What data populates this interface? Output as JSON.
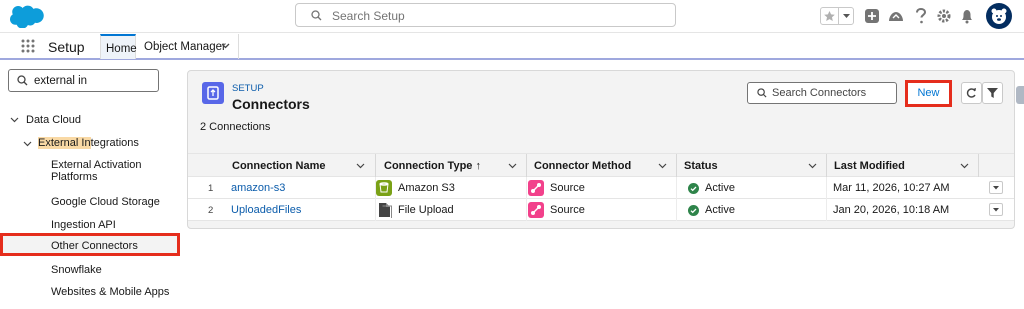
{
  "header": {
    "search_placeholder": "Search Setup",
    "icons": [
      "salesforce-cloud-logo",
      "favorites-star-icon",
      "favorites-dropdown-icon",
      "global-actions-plus-icon",
      "trailhead-icon",
      "help-icon",
      "setup-gear-icon",
      "notifications-bell-icon",
      "user-avatar"
    ]
  },
  "nav": {
    "app_name": "Setup",
    "tabs": [
      {
        "label": "Home"
      },
      {
        "label": "Object Manager"
      }
    ]
  },
  "sidebar": {
    "search_value": "external in",
    "tree": {
      "root": "Data Cloud",
      "group": "External Integrations",
      "group_highlight": "External In",
      "group_rest": "tegrations",
      "items": [
        {
          "label": "External Activation"
        },
        {
          "label": "Platforms"
        },
        {
          "label": "Google Cloud Storage"
        },
        {
          "label": "Ingestion API"
        },
        {
          "label": "Other Connectors"
        },
        {
          "label": "Snowflake"
        },
        {
          "label": "Websites & Mobile Apps"
        }
      ]
    }
  },
  "main": {
    "breadcrumb": "SETUP",
    "title": "Connectors",
    "count": "2 Connections",
    "search_placeholder": "Search Connectors",
    "new_label": "New",
    "columns": [
      {
        "label": "Connection Name"
      },
      {
        "label": "Connection Type ↑"
      },
      {
        "label": "Connector Method"
      },
      {
        "label": "Status"
      },
      {
        "label": "Last Modified"
      }
    ],
    "rows": [
      {
        "num": "1",
        "name": "amazon-s3",
        "type": "Amazon S3",
        "method": "Source",
        "status": "Active",
        "modified": "Mar 11, 2026, 10:27 AM"
      },
      {
        "num": "2",
        "name": "UploadedFiles",
        "type": "File Upload",
        "method": "Source",
        "status": "Active",
        "modified": "Jan 20, 2026, 10:18 AM"
      }
    ]
  },
  "colors": {
    "brand": "#0176d3",
    "highlight_box": "#e52d1c",
    "s3": "#7aa116",
    "method": "#f2418b",
    "active": "#2e844a"
  }
}
